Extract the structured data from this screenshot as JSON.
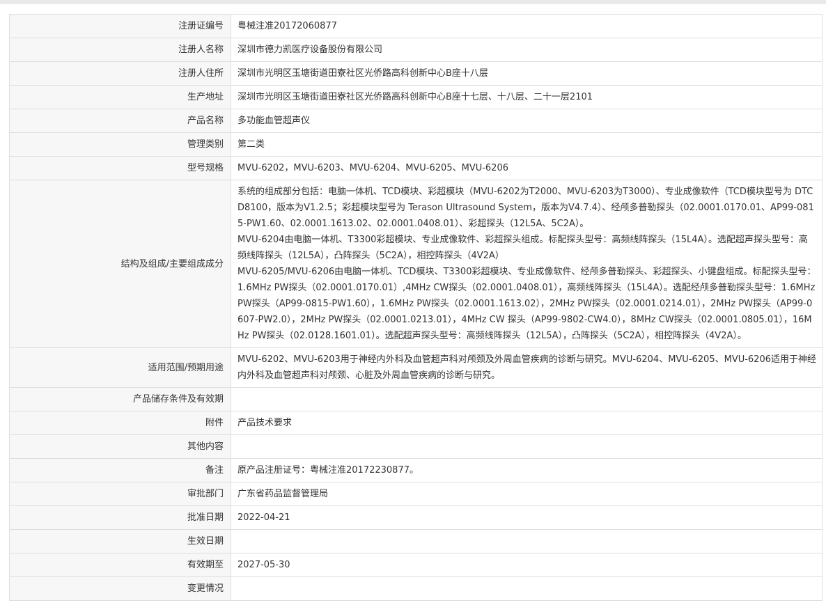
{
  "rows": [
    {
      "label": "注册证编号",
      "value": "粤械注准20172060877"
    },
    {
      "label": "注册人名称",
      "value": "深圳市德力凯医疗设备股份有限公司"
    },
    {
      "label": "注册人住所",
      "value": "深圳市光明区玉塘街道田寮社区光侨路高科创新中心B座十八层"
    },
    {
      "label": "生产地址",
      "value": "深圳市光明区玉塘街道田寮社区光侨路高科创新中心B座十七层、十八层、二十一层2101"
    },
    {
      "label": "产品名称",
      "value": "多功能血管超声仪"
    },
    {
      "label": "管理类别",
      "value": "第二类"
    },
    {
      "label": "型号规格",
      "value": "MVU-6202，MVU-6203、MVU-6204、MVU-6205、MVU-6206"
    },
    {
      "label": "结构及组成/主要组成成分",
      "paragraphs": [
        "系统的组成部分包括：电脑一体机、TCD模块、彩超模块（MVU-6202为T2000、MVU-6203为T3000）、专业成像软件（TCD模块型号为 DTCD8100，版本为V1.2.5；彩超模块型号为 Terason Ultrasound System，版本为V4.7.4）、经颅多普勒探头（02.0001.0170.01、AP99-0815-PW1.60、02.0001.1613.02、02.0001.0408.01）、彩超探头（12L5A、5C2A）。",
        "MVU-6204由电脑一体机、T3300彩超模块、专业成像软件、彩超探头组成。标配探头型号：高频线阵探头（15L4A）。选配超声探头型号：高频线阵探头（12L5A），凸阵探头（5C2A），相控阵探头（4V2A）",
        "MVU-6205/MVU-6206由电脑一体机、TCD模块、T3300彩超模块、专业成像软件、经颅多普勒探头、彩超探头、小键盘组成。标配探头型号：1.6MHz PW探头（02.0001.0170.01）,4MHz CW探头（02.0001.0408.01），高频线阵探头（15L4A）。选配经颅多普勒探头型号：1.6MHz PW探头（AP99-0815-PW1.60），1.6MHz PW探头（02.0001.1613.02），2MHz PW探头（02.0001.0214.01），2MHz PW探头（AP99-0607-PW2.0），2MHz PW探头（02.0001.0213.01），4MHz CW 探头（AP99-9802-CW4.0），8MHz CW探头（02.0001.0805.01），16MHz PW探头（02.0128.1601.01）。选配超声探头型号：高频线阵探头（12L5A），凸阵探头（5C2A），相控阵探头（4V2A）。"
      ]
    },
    {
      "label": "适用范围/预期用途",
      "value": "MVU-6202、MVU-6203用于神经内外科及血管超声科对颅颈及外周血管疾病的诊断与研究。MVU-6204、MVU-6205、MVU-6206适用于神经内外科及血管超声科对颅颈、心脏及外周血管疾病的诊断与研究。"
    },
    {
      "label": "产品储存条件及有效期",
      "value": ""
    },
    {
      "label": "附件",
      "value": "产品技术要求"
    },
    {
      "label": "其他内容",
      "value": ""
    },
    {
      "label": "备注",
      "value": "原产品注册证号：粤械注准20172230877。"
    },
    {
      "label": "审批部门",
      "value": "广东省药品监督管理局"
    },
    {
      "label": "批准日期",
      "value": "2022-04-21"
    },
    {
      "label": "生效日期",
      "value": ""
    },
    {
      "label": "有效期至",
      "value": "2027-05-30"
    },
    {
      "label": "变更情况",
      "value": ""
    }
  ]
}
